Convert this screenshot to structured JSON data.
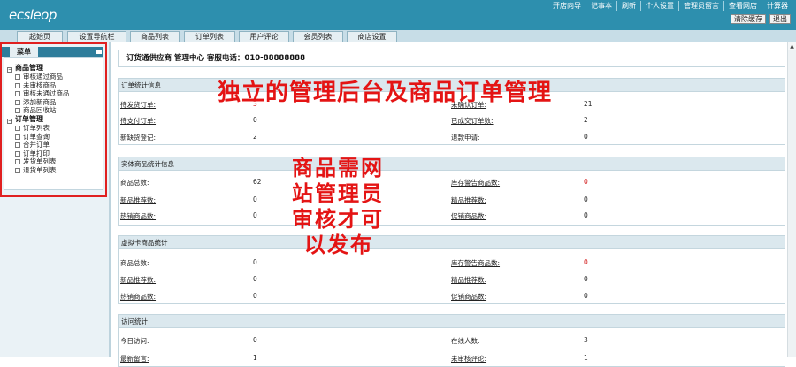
{
  "app": {
    "logo": "ecsleop"
  },
  "top_links": [
    "开店向导",
    "记事本",
    "刷新",
    "个人设置",
    "管理员留言",
    "查看网店",
    "计算器"
  ],
  "top_buttons": {
    "clear_cache": "清除缓存",
    "logout": "退出"
  },
  "tabs": [
    "起始页",
    "设置导航栏",
    "商品列表",
    "订单列表",
    "用户评论",
    "会员列表",
    "商店设置"
  ],
  "sidebar": {
    "title": "菜单",
    "groups": [
      {
        "label": "商品管理",
        "items": [
          "审核通过商品",
          "未审核商品",
          "审核未通过商品",
          "添加新商品",
          "商品回收站"
        ]
      },
      {
        "label": "订单管理",
        "items": [
          "订单列表",
          "订单查询",
          "合并订单",
          "订单打印",
          "发货单列表",
          "退货单列表"
        ]
      }
    ]
  },
  "info": "订货通供应商 管理中心 客服电话：010-88888888",
  "panels": {
    "orders": {
      "title": "订单统计信息",
      "rows": [
        {
          "l": "待发货订单:",
          "lv": "3",
          "r": "未确认订单:",
          "rv": "21"
        },
        {
          "l": "待支付订单:",
          "lv": "0",
          "r": "已成交订单数:",
          "rv": "2"
        },
        {
          "l": "新缺货登记:",
          "lv": "2",
          "r": "退款申请:",
          "rv": "0"
        }
      ]
    },
    "goods": {
      "title": "实体商品统计信息",
      "rows": [
        {
          "l": "商品总数:",
          "lv": "62",
          "r": "库存警告商品数:",
          "rv": "0"
        },
        {
          "l": "新品推荐数:",
          "lv": "0",
          "r": "精品推荐数:",
          "rv": "0"
        },
        {
          "l": "热销商品数:",
          "lv": "0",
          "r": "促销商品数:",
          "rv": "0"
        }
      ]
    },
    "virtual": {
      "title": "虚拟卡商品统计",
      "rows": [
        {
          "l": "商品总数:",
          "lv": "0",
          "r": "库存警告商品数:",
          "rv": "0"
        },
        {
          "l": "新品推荐数:",
          "lv": "0",
          "r": "精品推荐数:",
          "rv": "0"
        },
        {
          "l": "热销商品数:",
          "lv": "0",
          "r": "促销商品数:",
          "rv": "0"
        }
      ]
    },
    "visits": {
      "title": "访问统计",
      "rows": [
        {
          "l": "今日访问:",
          "lv": "0",
          "r": "在线人数:",
          "rv": "3"
        },
        {
          "l": "最新留言:",
          "lv": "1",
          "r": "未审核评论:",
          "rv": "1"
        }
      ]
    }
  },
  "annotations": {
    "headline": "独立的管理后台及商品订单管理",
    "note": [
      "商品需网",
      "站管理员",
      "审核才可",
      "以发布"
    ]
  },
  "colors": {
    "topbar": "#2d8fae",
    "annotation": "#e41414",
    "highlight_value": "#d01010"
  }
}
